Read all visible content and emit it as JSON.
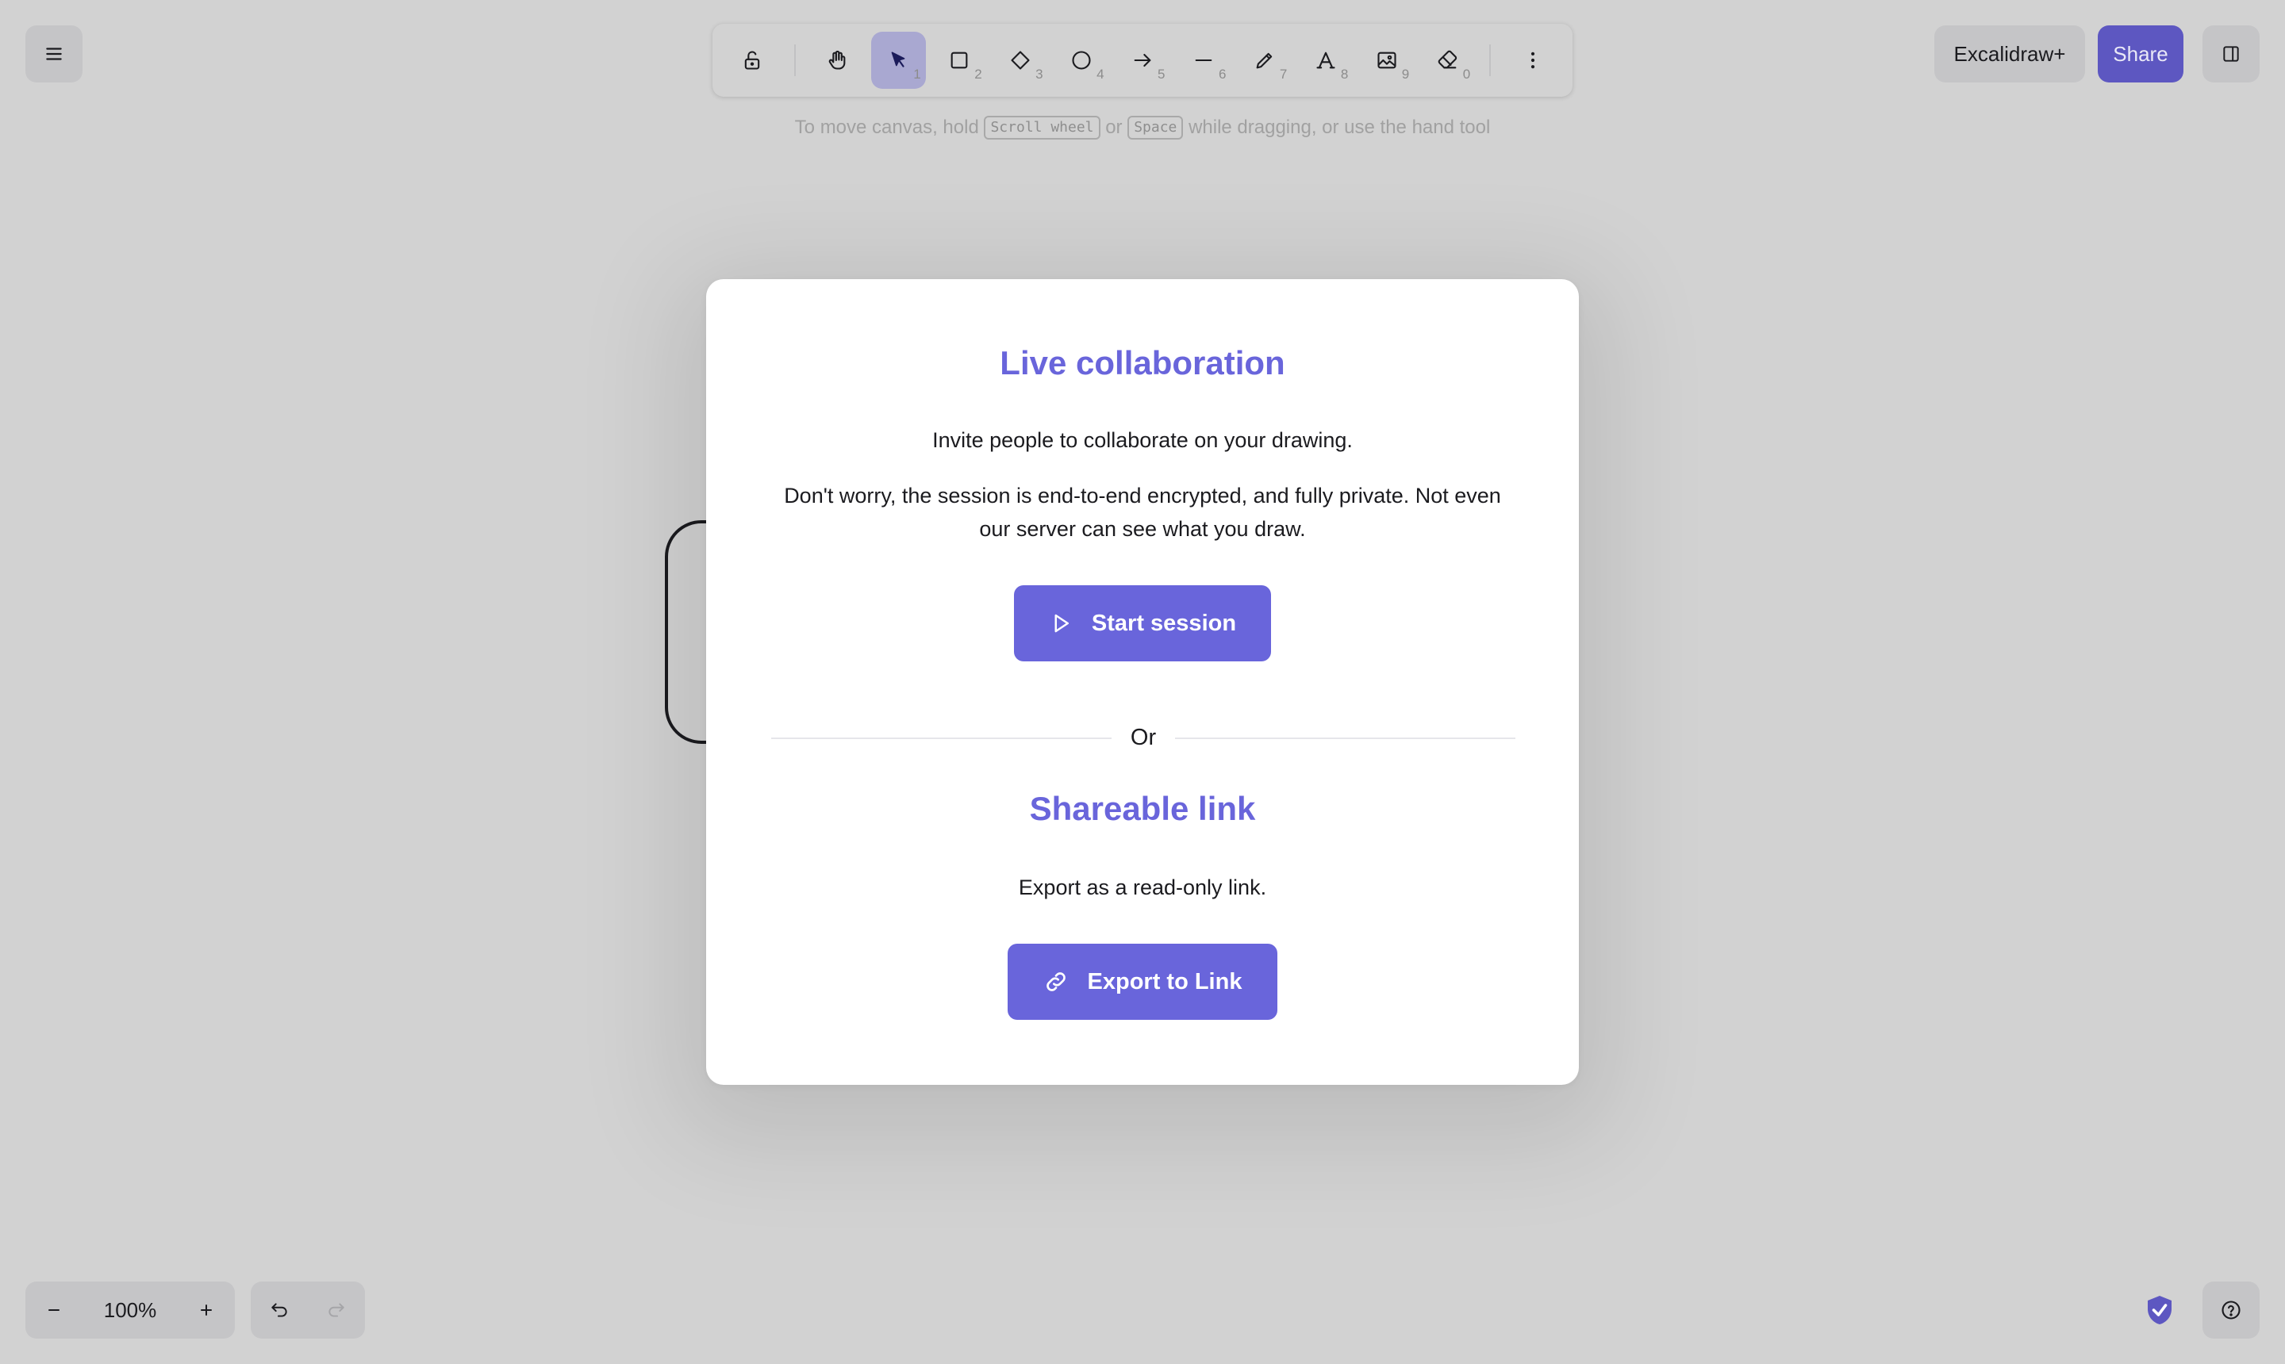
{
  "toolbar": {
    "tools": [
      {
        "name": "lock",
        "key": ""
      },
      {
        "name": "hand",
        "key": ""
      },
      {
        "name": "selection",
        "key": "1"
      },
      {
        "name": "rectangle",
        "key": "2"
      },
      {
        "name": "diamond",
        "key": "3"
      },
      {
        "name": "ellipse",
        "key": "4"
      },
      {
        "name": "arrow",
        "key": "5"
      },
      {
        "name": "line",
        "key": "6"
      },
      {
        "name": "draw",
        "key": "7"
      },
      {
        "name": "text",
        "key": "8"
      },
      {
        "name": "image",
        "key": "9"
      },
      {
        "name": "eraser",
        "key": "0"
      }
    ],
    "active_tool": "selection"
  },
  "hint": {
    "part1": "To move canvas, hold",
    "key1": "Scroll wheel",
    "part2": "or",
    "key2": "Space",
    "part3": "while dragging, or use the hand tool"
  },
  "header": {
    "plus_label": "Excalidraw+",
    "share_label": "Share"
  },
  "modal": {
    "live_title": "Live collaboration",
    "invite_text": "Invite people to collaborate on your drawing.",
    "privacy_text": "Don't worry, the session is end-to-end encrypted, and fully private. Not even our server can see what you draw.",
    "start_label": "Start session",
    "or_label": "Or",
    "link_title": "Shareable link",
    "export_text": "Export as a read-only link.",
    "export_label": "Export to Link"
  },
  "footer": {
    "zoom_value": "100%"
  },
  "colors": {
    "accent": "#6965db",
    "active_tool_bg": "#a9a8d1",
    "share_bg": "#5d57c1",
    "canvas_bg": "#d2d2d2"
  }
}
